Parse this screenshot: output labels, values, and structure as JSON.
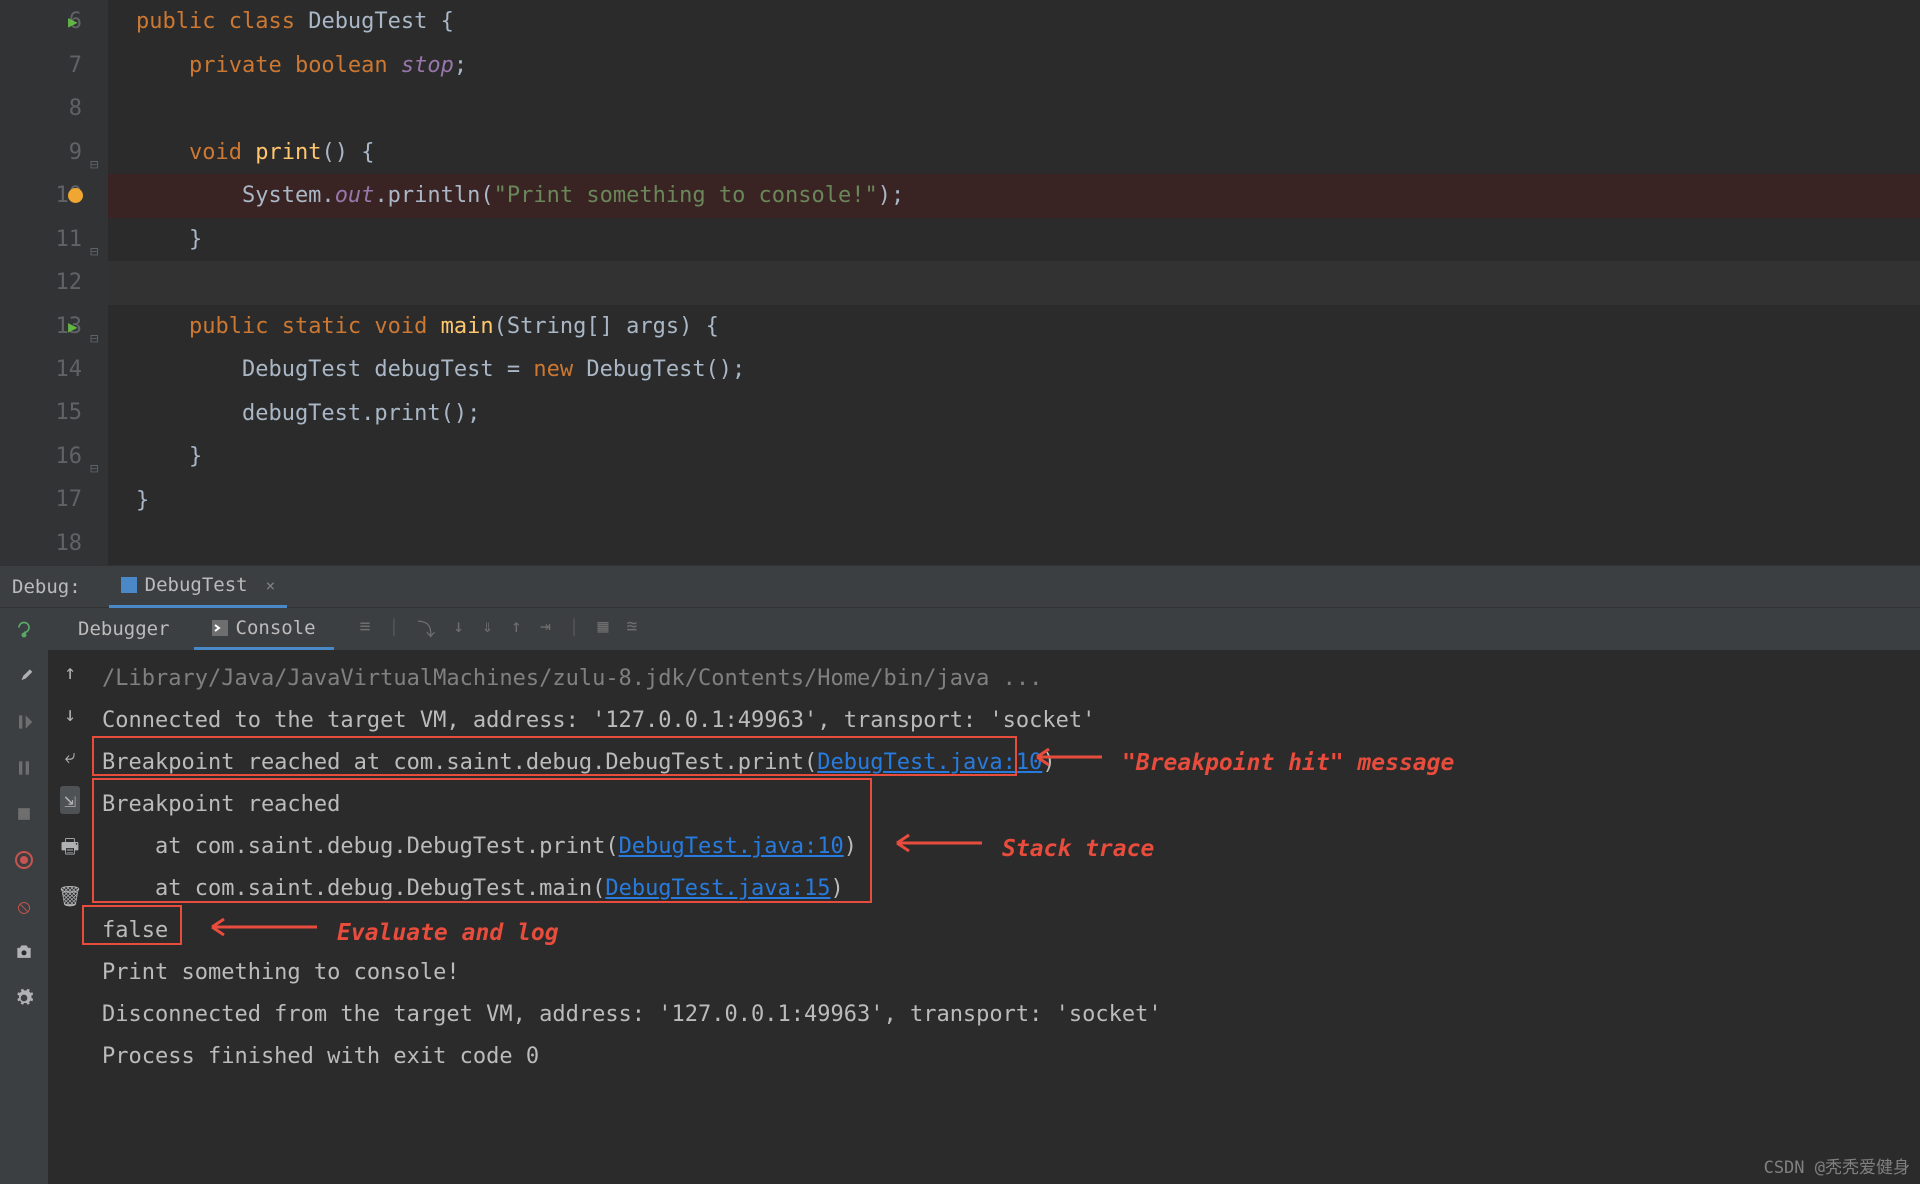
{
  "editor": {
    "lines": [
      {
        "num": "6",
        "run": true
      },
      {
        "num": "7"
      },
      {
        "num": "8"
      },
      {
        "num": "9",
        "fold": true
      },
      {
        "num": "10",
        "breakpoint": true
      },
      {
        "num": "11",
        "fold_close": true
      },
      {
        "num": "12"
      },
      {
        "num": "13",
        "run": true,
        "fold": true
      },
      {
        "num": "14"
      },
      {
        "num": "15"
      },
      {
        "num": "16",
        "fold_close": true
      },
      {
        "num": "17"
      },
      {
        "num": "18"
      }
    ],
    "code": {
      "l6_kw1": "public class",
      "l6_name": " DebugTest ",
      "l6_brace": "{",
      "l7_kw": "private boolean",
      "l7_field": " stop",
      "l7_semi": ";",
      "l9_kw": "void",
      "l9_method": " print",
      "l9_rest": "() {",
      "l10_prefix": "        System.",
      "l10_out": "out",
      "l10_println": ".println(",
      "l10_str": "\"Print something to console!\"",
      "l10_end": ");",
      "l11_brace": "    }",
      "l13_kw": "public static void",
      "l13_method": " main",
      "l13_args": "(String[] args) {",
      "l14_type": "        DebugTest",
      "l14_var": " debugTest = ",
      "l14_new": "new",
      "l14_ctor": " DebugTest();",
      "l15_call": "        debugTest.print();",
      "l16_brace": "    }",
      "l17_brace": "}"
    }
  },
  "debug_bar": {
    "label": "Debug:",
    "tab": "DebugTest",
    "close": "×"
  },
  "console_tabs": {
    "debugger": "Debugger",
    "console": "Console"
  },
  "console": {
    "cmd": "/Library/Java/JavaVirtualMachines/zulu-8.jdk/Contents/Home/bin/java ...",
    "l1": "Connected to the target VM, address: '127.0.0.1:49963', transport: 'socket'",
    "l2a": "Breakpoint reached at com.saint.debug.DebugTest.print(",
    "l2link": "DebugTest.java:10",
    "l2b": ")",
    "l3": "Breakpoint reached",
    "l4a": "    at com.saint.debug.DebugTest.print(",
    "l4link": "DebugTest.java:10",
    "l4b": ")",
    "l5a": "    at com.saint.debug.DebugTest.main(",
    "l5link": "DebugTest.java:15",
    "l5b": ")",
    "l6": "false",
    "l7": "Print something to console!",
    "l8": "Disconnected from the target VM, address: '127.0.0.1:49963', transport: 'socket'",
    "l9": "",
    "l10": "Process finished with exit code 0"
  },
  "annotations": {
    "a1": "\"Breakpoint hit\" message",
    "a2": "Stack trace",
    "a3": "Evaluate and log"
  },
  "watermark": "CSDN @秃秃爱健身"
}
